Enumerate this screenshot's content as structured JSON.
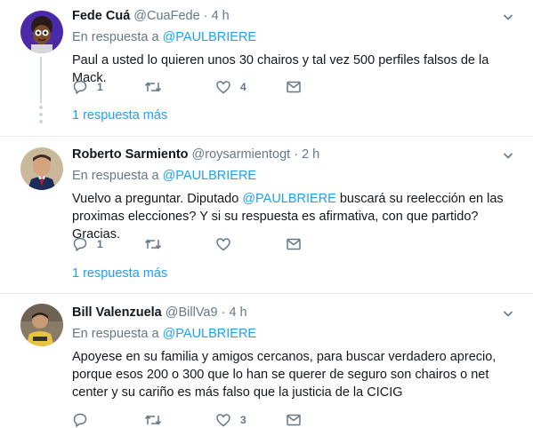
{
  "tweets": [
    {
      "name": "Fede Cuá",
      "handle": "@CuaFede",
      "sep": "·",
      "time": "4 h",
      "reply_prefix": "En respuesta a",
      "reply_to": "@PAULBRIERE",
      "text": "Paul a usted lo quieren unos 30 chairos y tal vez 500 perfiles falsos de la Mack.",
      "replies": "1",
      "retweets": "",
      "likes": "4",
      "more_replies": "1 respuesta más"
    },
    {
      "name": "Roberto Sarmiento",
      "handle": "@roysarmientogt",
      "sep": "·",
      "time": "2 h",
      "reply_prefix": "En respuesta a",
      "reply_to": "@PAULBRIERE",
      "text_before": "Vuelvo a preguntar. Diputado ",
      "text_mention": "@PAULBRIERE",
      "text_after": " buscará su reelección en las proximas elecciones? Y si su respuesta es afirmativa, con que partido? Gracias.",
      "replies": "1",
      "retweets": "",
      "likes": "",
      "more_replies": "1 respuesta más"
    },
    {
      "name": "Bill Valenzuela",
      "handle": "@BillVa9",
      "sep": "·",
      "time": "4 h",
      "reply_prefix": "En respuesta a",
      "reply_to": "@PAULBRIERE",
      "text": "Apoyese en su familia y amigos cercanos, para buscar verdadero aprecio, porque esos 200 o 300 que lo han se querer de seguro son chairos o net center y su cariño es más falso que la justicia de la CICIG",
      "replies": "",
      "retweets": "",
      "likes": "3",
      "more_replies": ""
    }
  ],
  "icons": [
    "reply-icon",
    "retweet-icon",
    "like-icon",
    "message-icon",
    "chevron-down-icon"
  ],
  "colors": {
    "link": "#1da1f2",
    "muted": "#657786",
    "text": "#14171a",
    "divider": "#e6ecf0",
    "thread": "#ccd6dd"
  }
}
